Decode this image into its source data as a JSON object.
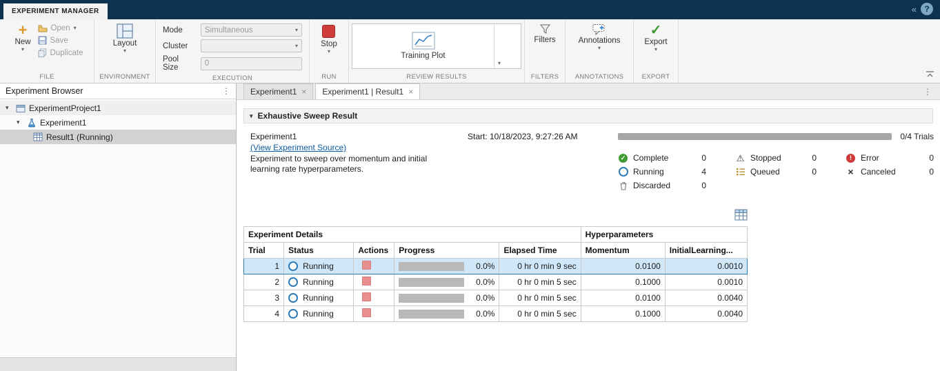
{
  "titlebar": {
    "app_tab": "EXPERIMENT MANAGER"
  },
  "glyphs": {
    "caret": "▾",
    "close": "×",
    "kebab": "⋮",
    "chevron_left": "«",
    "question": "?",
    "check": "✓",
    "warning": "⚠",
    "cross": "×",
    "plus": "+",
    "exclaim": "!"
  },
  "toolbar": {
    "file": {
      "new": "New",
      "open": "Open",
      "save": "Save",
      "duplicate": "Duplicate",
      "label": "FILE"
    },
    "environment": {
      "layout": "Layout",
      "label": "ENVIRONMENT"
    },
    "execution": {
      "mode_label": "Mode",
      "mode_value": "Simultaneous",
      "cluster_label": "Cluster",
      "cluster_value": "",
      "poolsize_label": "Pool Size",
      "poolsize_value": "0",
      "label": "EXECUTION"
    },
    "run": {
      "stop": "Stop",
      "label": "RUN"
    },
    "review": {
      "training_plot": "Training Plot",
      "label": "REVIEW RESULTS"
    },
    "filters": {
      "filters": "Filters",
      "label": "FILTERS"
    },
    "annotations": {
      "annotations": "Annotations",
      "label": "ANNOTATIONS"
    },
    "export": {
      "export": "Export",
      "label": "EXPORT"
    }
  },
  "browser": {
    "title": "Experiment Browser",
    "tree": [
      {
        "label": "ExperimentProject1"
      },
      {
        "label": "Experiment1"
      },
      {
        "label": "Result1 (Running)"
      }
    ]
  },
  "tabs": [
    {
      "label": "Experiment1"
    },
    {
      "label": "Experiment1 | Result1"
    }
  ],
  "result": {
    "section_title": "Exhaustive Sweep Result",
    "experiment_name": "Experiment1",
    "source_link": "(View Experiment Source)",
    "description": "Experiment to sweep over momentum and initial learning rate hyperparameters.",
    "start": "Start: 10/18/2023, 9:27:26 AM",
    "trials": "0/4 Trials",
    "statuses": [
      {
        "name": "Complete",
        "count": "0"
      },
      {
        "name": "Running",
        "count": "4"
      },
      {
        "name": "Discarded",
        "count": "0"
      },
      {
        "name": "Stopped",
        "count": "0"
      },
      {
        "name": "Queued",
        "count": "0"
      },
      {
        "name": "Error",
        "count": "0"
      },
      {
        "name": "Canceled",
        "count": "0"
      }
    ]
  },
  "table": {
    "group_headers": [
      "Experiment Details",
      "Hyperparameters"
    ],
    "columns": [
      "Trial",
      "Status",
      "Actions",
      "Progress",
      "Elapsed Time",
      "Momentum",
      "InitialLearning..."
    ],
    "rows": [
      {
        "trial": "1",
        "status": "Running",
        "progress": "0.0%",
        "elapsed": "0 hr 0 min 9 sec",
        "momentum": "0.0100",
        "initial_learning": "0.0010"
      },
      {
        "trial": "2",
        "status": "Running",
        "progress": "0.0%",
        "elapsed": "0 hr 0 min 5 sec",
        "momentum": "0.1000",
        "initial_learning": "0.0010"
      },
      {
        "trial": "3",
        "status": "Running",
        "progress": "0.0%",
        "elapsed": "0 hr 0 min 5 sec",
        "momentum": "0.0100",
        "initial_learning": "0.0040"
      },
      {
        "trial": "4",
        "status": "Running",
        "progress": "0.0%",
        "elapsed": "0 hr 0 min 5 sec",
        "momentum": "0.1000",
        "initial_learning": "0.0040"
      }
    ]
  },
  "colors": {
    "titlebar": "#0d3150",
    "selection": "#cfe7f8",
    "link": "#0b5aa0",
    "stop_red": "#ce3c3c",
    "export_green": "#3f9c35",
    "running_blue": "#2e7bb8",
    "error_red": "#d03a3a"
  }
}
